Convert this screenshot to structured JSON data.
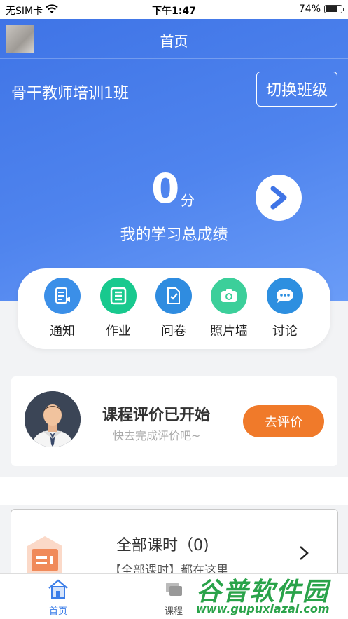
{
  "status_bar": {
    "carrier": "无SIM卡",
    "time": "下午1:47",
    "battery": "74%",
    "battery_level": 0.74
  },
  "header": {
    "title": "首页",
    "class_name": "骨干教师培训1班",
    "switch_label": "切换班级"
  },
  "score": {
    "value": "0",
    "unit": "分",
    "label": "我的学习总成绩"
  },
  "menu": {
    "items": [
      {
        "label": "通知",
        "icon": "notice-icon",
        "color": "#3b8fe8"
      },
      {
        "label": "作业",
        "icon": "homework-icon",
        "color": "#18c98e"
      },
      {
        "label": "问卷",
        "icon": "survey-icon",
        "color": "#2f8ce0"
      },
      {
        "label": "照片墙",
        "icon": "camera-icon",
        "color": "#3ccf9a"
      },
      {
        "label": "讨论",
        "icon": "chat-icon",
        "color": "#2d8fe0"
      }
    ]
  },
  "evaluation": {
    "title": "课程评价已开始",
    "subtitle": "快去完成评价吧~",
    "button": "去评价",
    "button_color": "#f07a2a"
  },
  "courses": {
    "title": "全部课时（0)",
    "subtitle": "【全部课时】都在这里"
  },
  "tabbar": {
    "items": [
      {
        "label": "首页",
        "icon": "home-icon",
        "active": true
      },
      {
        "label": "课程",
        "icon": "course-icon",
        "active": false
      }
    ],
    "active_color": "#3b7de8"
  },
  "watermark": {
    "brand": "谷普软件园",
    "url": "www.gupuxlazai.com"
  }
}
